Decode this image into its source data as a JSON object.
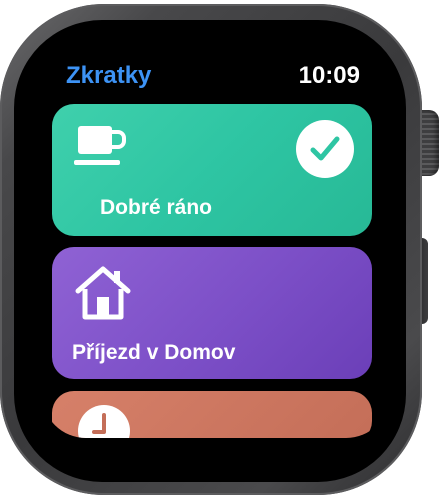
{
  "status_bar": {
    "app_title": "Zkratky",
    "time": "10:09"
  },
  "shortcuts": [
    {
      "label": "Dobré ráno",
      "icon": "coffee-cup-icon",
      "color": "#2ec5a3",
      "state": "completed",
      "badge_icon": "checkmark-icon"
    },
    {
      "label": "Příjezd v Domov",
      "icon": "home-icon",
      "color": "#7c4fc7"
    },
    {
      "label": "",
      "icon": "clock-icon",
      "color": "#c46e58"
    }
  ],
  "colors": {
    "accent": "#3d93f5",
    "background": "#000000"
  }
}
